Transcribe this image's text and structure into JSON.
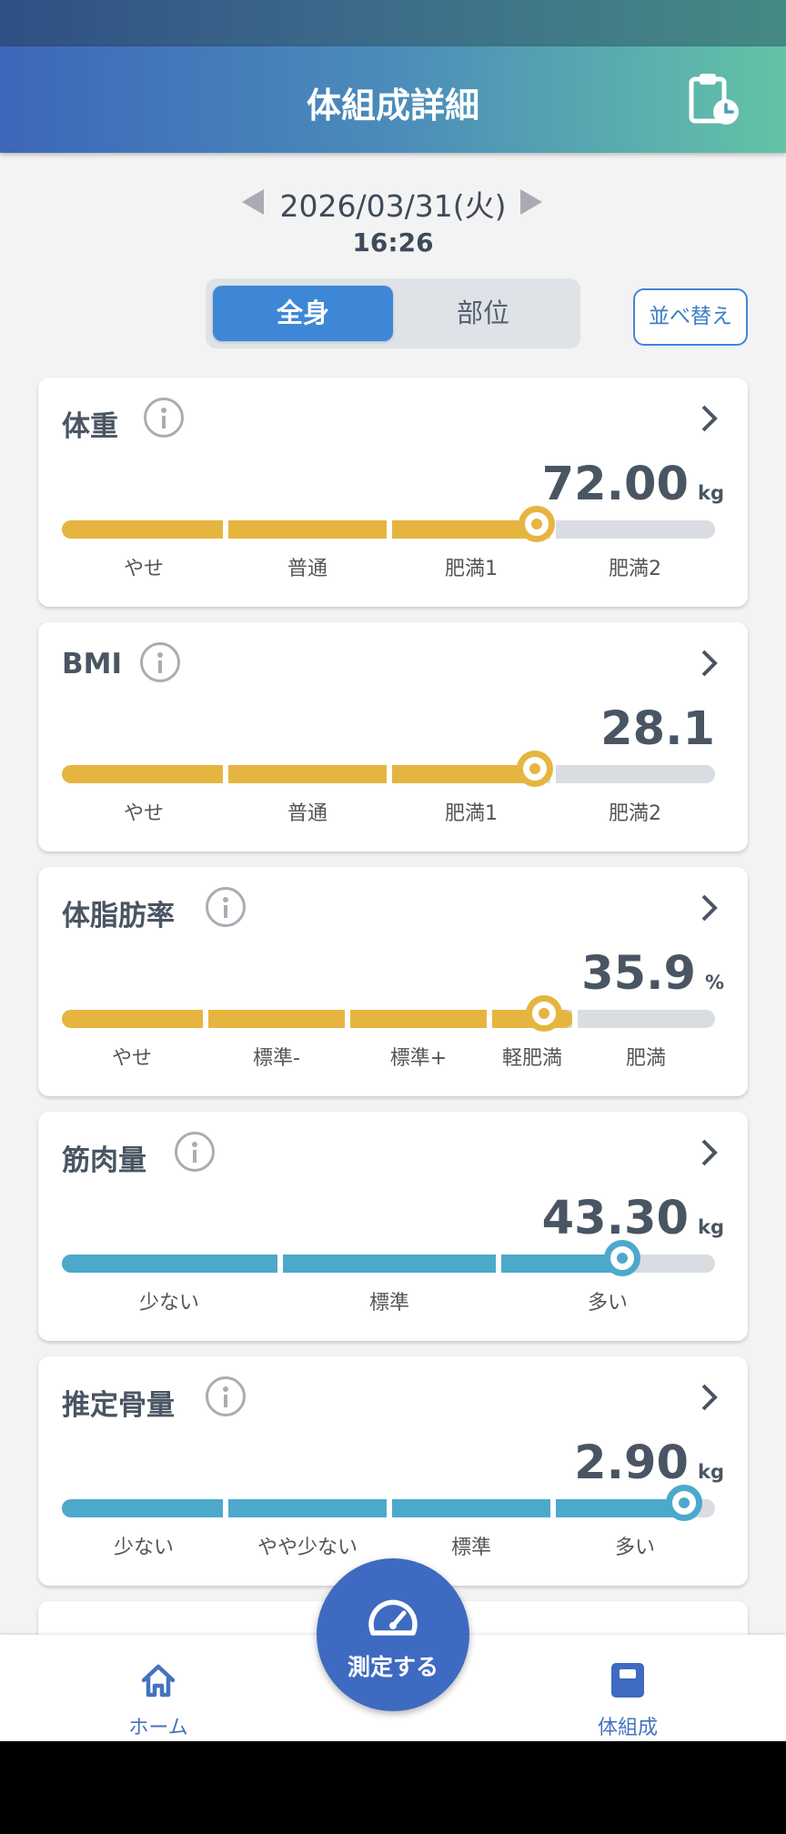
{
  "header": {
    "title": "体組成詳細",
    "history_icon": "clipboard-clock-icon"
  },
  "date": {
    "date": "2026/03/31(火)",
    "time": "16:26"
  },
  "tabs": [
    {
      "label": "全身",
      "active": true
    },
    {
      "label": "部位",
      "active": false
    }
  ],
  "sort_label": "並べ替え",
  "colors": {
    "yellow": "#e6b53f",
    "blue": "#4ca9cc",
    "accent": "#3d87d6",
    "fab": "#3e6ac1"
  },
  "cards": [
    {
      "title": "体重",
      "value": "72.00",
      "unit": "kg",
      "labels": [
        "やせ",
        "普通",
        "肥満1",
        "肥満2"
      ]
    },
    {
      "title": "BMI",
      "value": "28.1",
      "unit": "",
      "labels": [
        "やせ",
        "普通",
        "肥満1",
        "肥満2"
      ]
    },
    {
      "title": "体脂肪率",
      "value": "35.9",
      "unit": "%",
      "labels": [
        "やせ",
        "標準-",
        "標準+",
        "軽肥満",
        "肥満"
      ]
    },
    {
      "title": "筋肉量",
      "value": "43.30",
      "unit": "kg",
      "labels": [
        "少ない",
        "標準",
        "多い"
      ]
    },
    {
      "title": "推定骨量",
      "value": "2.90",
      "unit": "kg",
      "labels": [
        "少ない",
        "やや少ない",
        "標準",
        "多い"
      ]
    }
  ],
  "nav": {
    "home": {
      "label": "ホーム",
      "icon": "home-icon"
    },
    "body": {
      "label": "体組成",
      "icon": "body-composition-icon"
    }
  },
  "fab": {
    "label": "測定する",
    "icon": "speedometer-icon"
  }
}
